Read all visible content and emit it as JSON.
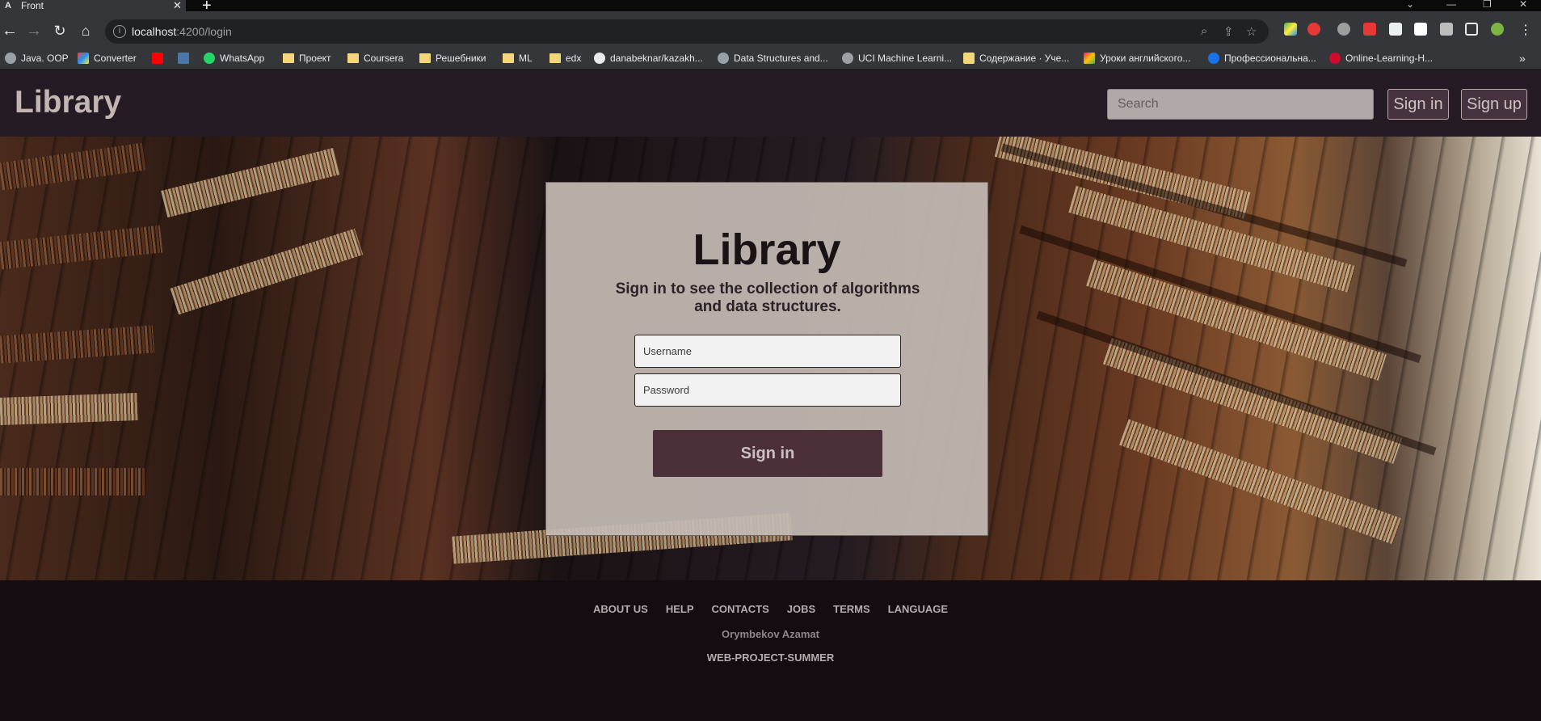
{
  "browser": {
    "tab_title": "Front",
    "tab_favicon": "A",
    "url_host": "localhost",
    "url_path": ":4200/login",
    "bookmarks": [
      {
        "label": "Java. OOP",
        "icon": "globe-icon"
      },
      {
        "label": "Converter",
        "icon": "converter-icon"
      },
      {
        "label": "",
        "icon": "youtube-icon"
      },
      {
        "label": "",
        "icon": "vk-icon"
      },
      {
        "label": "WhatsApp",
        "icon": "whatsapp-icon"
      },
      {
        "label": "Проект",
        "icon": "folder-icon"
      },
      {
        "label": "Coursera",
        "icon": "folder-icon"
      },
      {
        "label": "Решебники",
        "icon": "folder-icon"
      },
      {
        "label": "ML",
        "icon": "folder-icon"
      },
      {
        "label": "edx",
        "icon": "folder-icon"
      },
      {
        "label": "danabeknar/kazakh...",
        "icon": "github-icon"
      },
      {
        "label": "Data Structures and...",
        "icon": "globe-icon"
      },
      {
        "label": "UCI Machine Learni...",
        "icon": "globe-icon"
      },
      {
        "label": "Содержание · Уче...",
        "icon": "book-icon"
      },
      {
        "label": "Уроки английского...",
        "icon": "flower-icon"
      },
      {
        "label": "Профессиональна...",
        "icon": "c-icon"
      },
      {
        "label": "Online-Learning-H...",
        "icon": "huawei-icon"
      }
    ]
  },
  "header": {
    "logo": "Library",
    "search_placeholder": "Search",
    "signin_label": "Sign in",
    "signup_label": "Sign up"
  },
  "login": {
    "title": "Library",
    "subtitle": "Sign in to see the collection of algorithms and data structures.",
    "username_placeholder": "Username",
    "password_placeholder": "Password",
    "submit_label": "Sign in"
  },
  "footer": {
    "links": [
      "ABOUT US",
      "HELP",
      "CONTACTS",
      "JOBS",
      "TERMS",
      "LANGUAGE"
    ],
    "author": "Orymbekov Azamat",
    "project": "WEB-PROJECT-SUMMER"
  },
  "colors": {
    "header_bg": "#251b25",
    "footer_bg": "#150c12",
    "button_accent": "#4c3039",
    "card_bg": "#c4bab4"
  }
}
